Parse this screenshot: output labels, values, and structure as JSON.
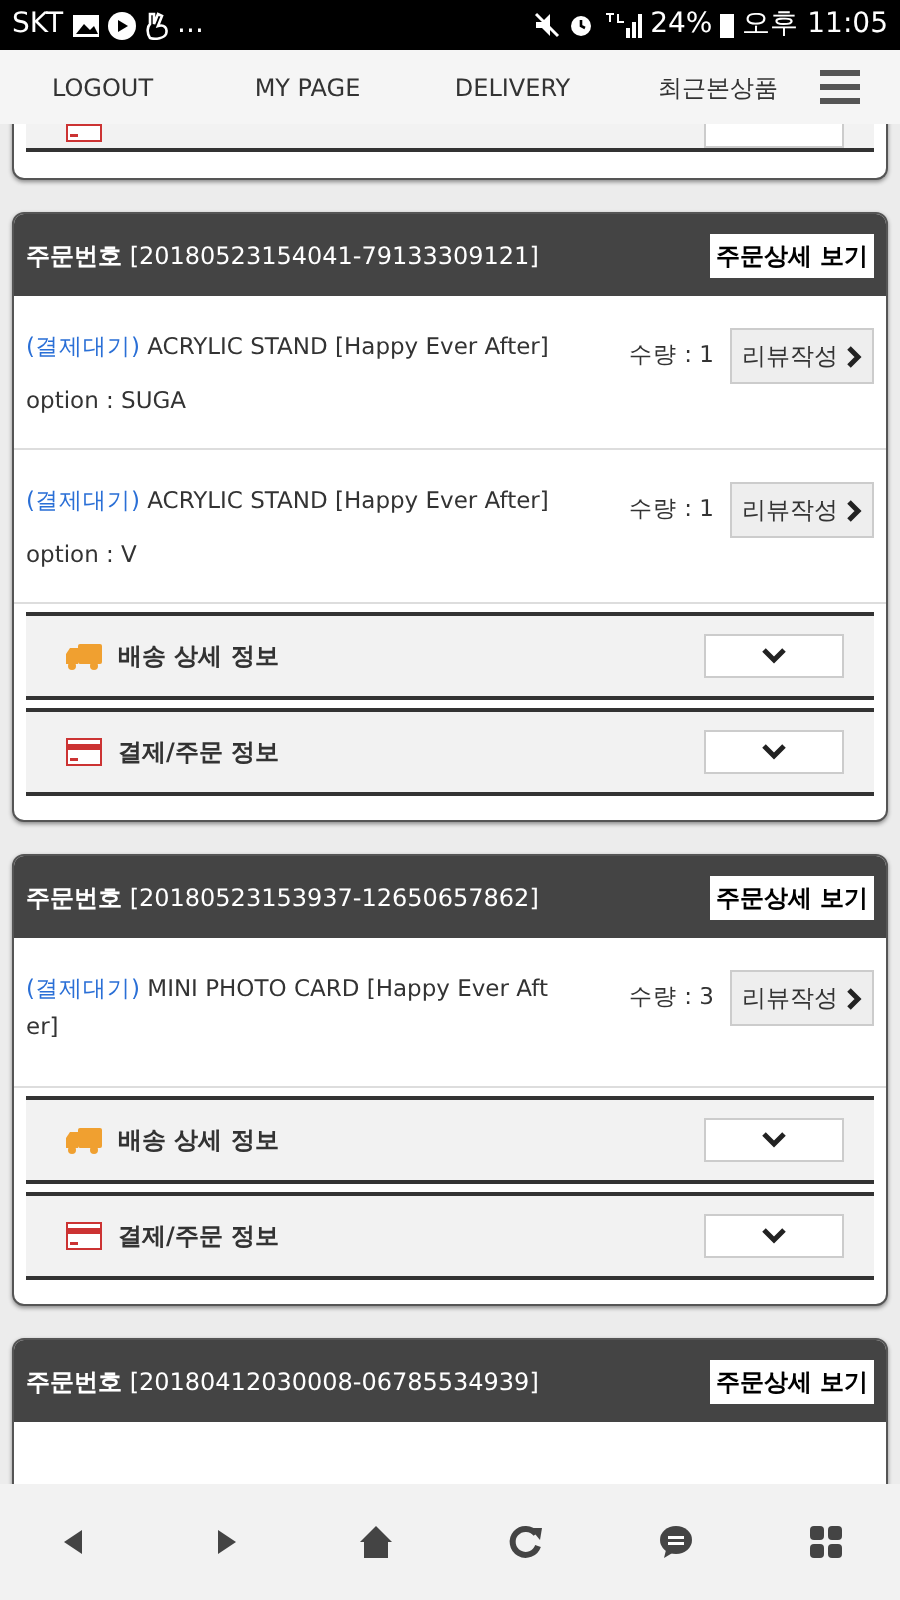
{
  "status_bar": {
    "carrier": "SKT",
    "more": "...",
    "battery": "24%",
    "time": "오후 11:05"
  },
  "nav": [
    {
      "label": "LOGOUT",
      "kind": "text"
    },
    {
      "label": "MY PAGE",
      "kind": "text"
    },
    {
      "label": "DELIVERY",
      "kind": "text"
    },
    {
      "label": "최근본상품",
      "kind": "text"
    },
    {
      "kind": "menu"
    }
  ],
  "orders": [
    {
      "sections": [
        {
          "kind": "payment"
        }
      ]
    },
    {
      "title": "**주문번호** [20180523154041-79133309121]",
      "detail_button": "주문상세 보기",
      "items": [
        {
          "status": "(결제대기)",
          "name": "ACRYLIC STAND [Happy Ever After]",
          "option": "option : SUGA",
          "quantity": "수량 : 1",
          "review_button": "리뷰작성"
        },
        {
          "status": "(결제대기)",
          "name": "ACRYLIC STAND [Happy Ever After]",
          "option": "option : V",
          "quantity": "수량 : 1",
          "review_button": "리뷰작성"
        }
      ],
      "sections": [
        {
          "kind": "delivery",
          "label": "배송 상세 정보"
        },
        {
          "kind": "payment",
          "label": "결제/주문 정보"
        }
      ]
    },
    {
      "title": "**주문번호** [20180523153937-12650657862]",
      "detail_button": "주문상세 보기",
      "items": [
        {
          "status": "(결제대기)",
          "name": "MINI PHOTO CARD [Happy Ever After]",
          "quantity": "수량 : 3",
          "review_button": "리뷰작성"
        }
      ],
      "sections": [
        {
          "kind": "delivery",
          "label": "배송 상세 정보"
        },
        {
          "kind": "payment",
          "label": "결제/주문 정보"
        }
      ]
    },
    {
      "title": "**주문번호** [20180412030008-06785534939]",
      "detail_button": "주문상세 보기"
    }
  ],
  "bottom_bar": [
    {
      "kind": "back"
    },
    {
      "kind": "forward"
    },
    {
      "kind": "home"
    },
    {
      "kind": "reload"
    },
    {
      "kind": "chat"
    },
    {
      "kind": "apps"
    }
  ]
}
